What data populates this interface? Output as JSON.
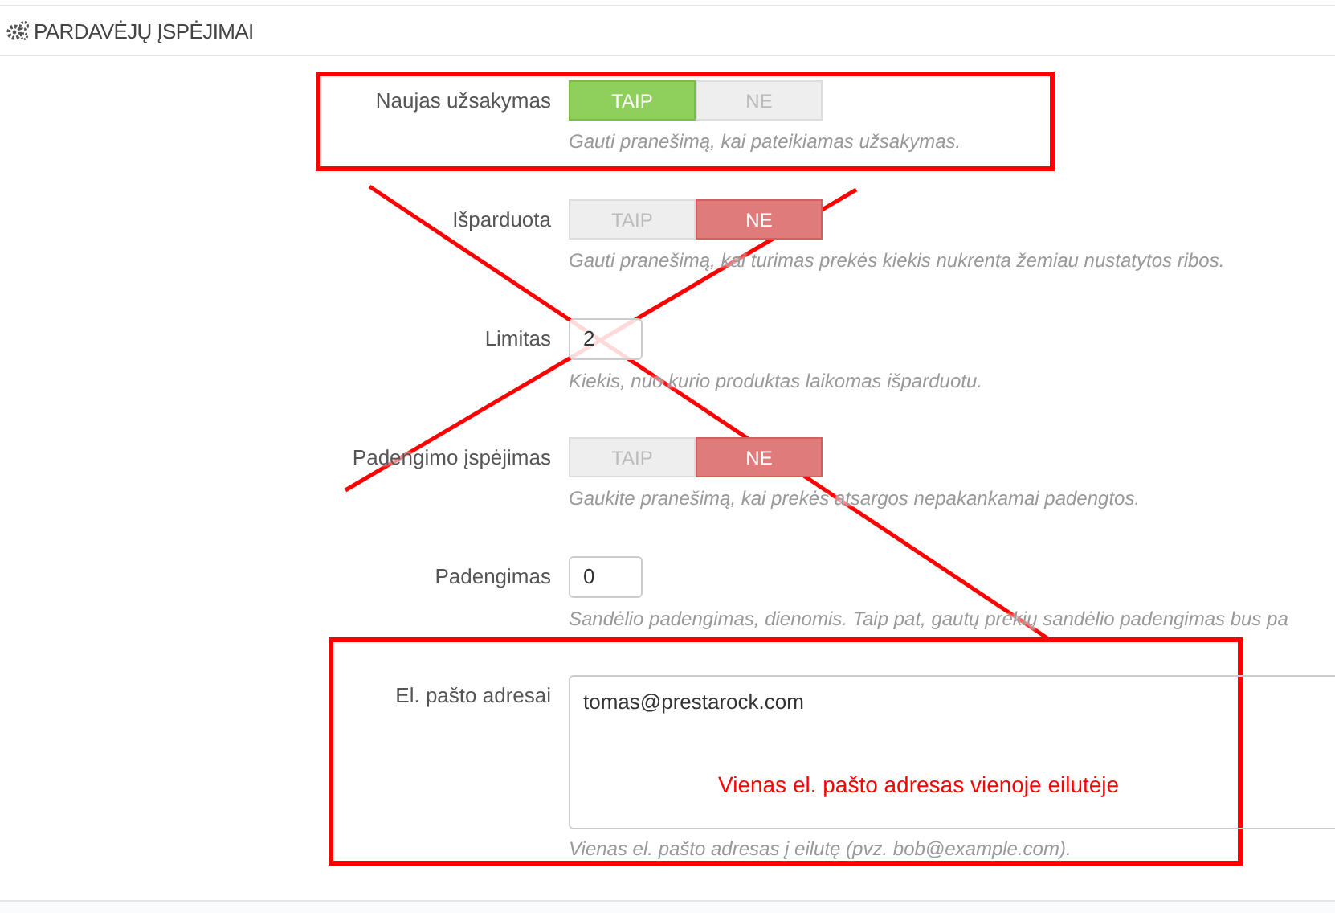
{
  "panel": {
    "title": "PARDAVĖJŲ ĮSPĖJIMAI"
  },
  "fields": [
    {
      "kind": "toggle",
      "label": "Naujas užsakymas",
      "options": [
        {
          "label": "TAIP",
          "selected": true
        },
        {
          "label": "NE",
          "selected": false
        }
      ],
      "hint": "Gauti pranešimą, kai pateikiamas užsakymas."
    },
    {
      "kind": "toggle",
      "label": "Išparduota",
      "options": [
        {
          "label": "TAIP",
          "selected": false
        },
        {
          "label": "NE",
          "selected": true
        }
      ],
      "hint": "Gauti pranešimą, kai turimas prekės kiekis nukrenta žemiau nustatytos ribos."
    },
    {
      "kind": "number",
      "label": "Limitas",
      "value": "2",
      "hint": "Kiekis, nuo kurio produktas laikomas išparduotu."
    },
    {
      "kind": "toggle",
      "label": "Padengimo įspėjimas",
      "options": [
        {
          "label": "TAIP",
          "selected": false
        },
        {
          "label": "NE",
          "selected": true
        }
      ],
      "hint": "Gaukite pranešimą, kai prekės atsargos nepakankamai padengtos."
    },
    {
      "kind": "number",
      "label": "Padengimas",
      "value": "0",
      "hint": "Sandėlio padengimas, dienomis. Taip pat, gautų prekių sandėlio padengimas bus pa"
    },
    {
      "kind": "textarea",
      "label": "El. pašto adresai",
      "value": "tomas@prestarock.com",
      "hint": "Vienas el. pašto adresas į eilutę (pvz. bob@example.com)."
    }
  ],
  "annotation": {
    "note": "Vienas el. pašto adresas vienoje eilutėje"
  }
}
